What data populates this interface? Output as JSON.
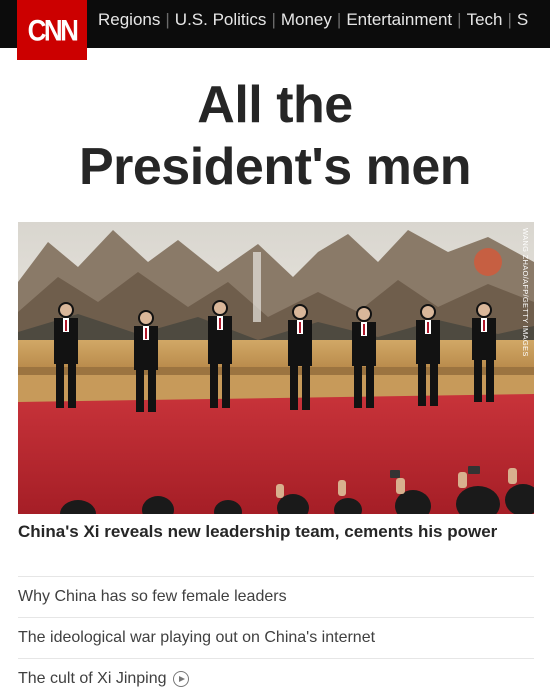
{
  "brand": {
    "logo_text": "CNN",
    "accent": "#cc0000"
  },
  "nav": {
    "items": [
      {
        "label": "Regions"
      },
      {
        "label": "U.S. Politics"
      },
      {
        "label": "Money"
      },
      {
        "label": "Entertainment"
      },
      {
        "label": "Tech"
      },
      {
        "label": "S"
      }
    ]
  },
  "headline": {
    "line1": "All the",
    "line2": "President's men"
  },
  "photo": {
    "credit": "WANG ZHAO/AFP/GETTY IMAGES"
  },
  "lead": {
    "title": "China's Xi reveals new leadership team, cements his power"
  },
  "related": [
    {
      "label": "Why China has so few female leaders",
      "icon": ""
    },
    {
      "label": "The ideological war playing out on China's internet",
      "icon": ""
    },
    {
      "label": "The cult of Xi Jinping",
      "icon": "play-icon"
    }
  ]
}
